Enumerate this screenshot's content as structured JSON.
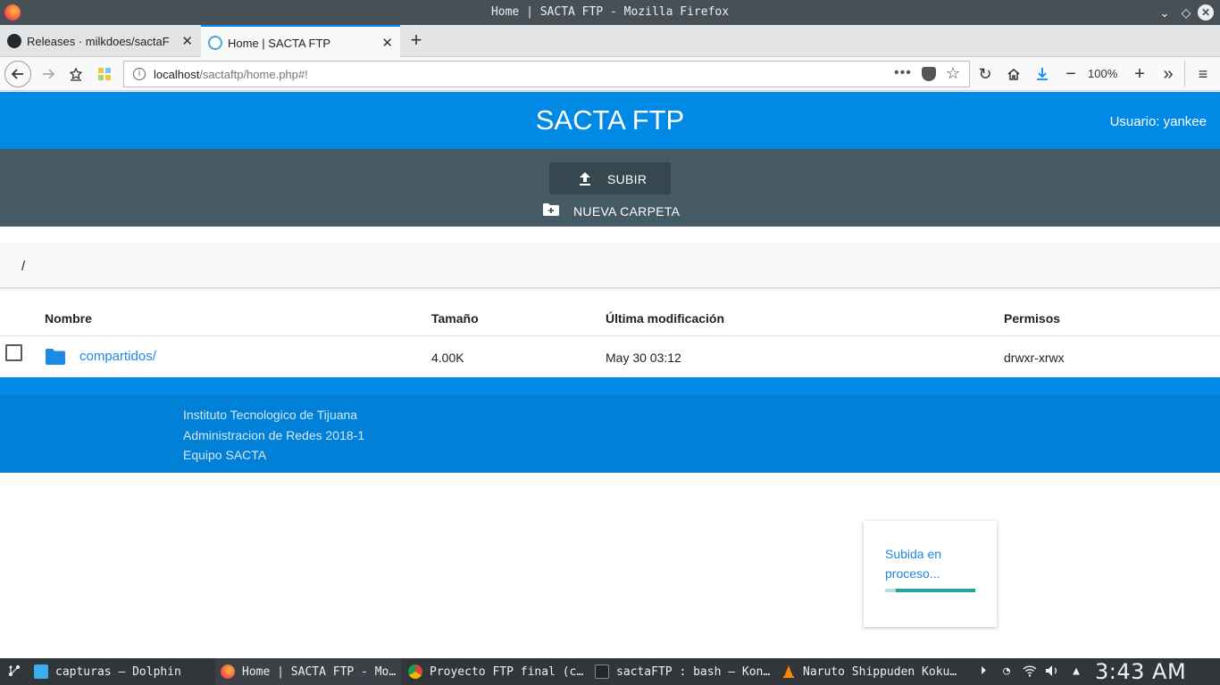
{
  "window": {
    "title": "Home | SACTA FTP - Mozilla Firefox"
  },
  "browser": {
    "tabs": [
      {
        "label": "Releases · milkdoes/sactaFT",
        "active": false
      },
      {
        "label": "Home | SACTA FTP",
        "active": true
      }
    ],
    "url_host": "localhost",
    "url_path": "/sactaftp/home.php#!",
    "zoom": "100%"
  },
  "app": {
    "brand": "SACTA FTP",
    "user_label": "Usuario: yankee",
    "upload_label": "SUBIR",
    "new_folder_label": "NUEVA CARPETA",
    "breadcrumb": "/"
  },
  "table": {
    "columns": [
      "Nombre",
      "Tamaño",
      "Última modificación",
      "Permisos"
    ],
    "rows": [
      {
        "name": "compartidos/",
        "size": "4.00K",
        "modified": "May 30 03:12",
        "perms": "drwxr-xrwx"
      }
    ]
  },
  "footer": {
    "lines": [
      "Instituto Tecnologico de Tijuana",
      "Administracion de Redes 2018-1",
      "Equipo SACTA"
    ]
  },
  "toast": {
    "message": "Subida en proceso...",
    "progress": 0.88
  },
  "taskbar": {
    "tasks": [
      {
        "label": "capturas — Dolphin"
      },
      {
        "label": "Home | SACTA FTP - Mo…"
      },
      {
        "label": "Proyecto FTP final (c…"
      },
      {
        "label": "sactaFTP : bash — Kon…"
      },
      {
        "label": "Naruto Shippuden Koku…"
      }
    ],
    "clock": "3:43 AM"
  },
  "colors": {
    "primary": "#008ae6",
    "toolbar": "#455a64",
    "link": "#1e88e5",
    "progress": "#26a69a"
  }
}
